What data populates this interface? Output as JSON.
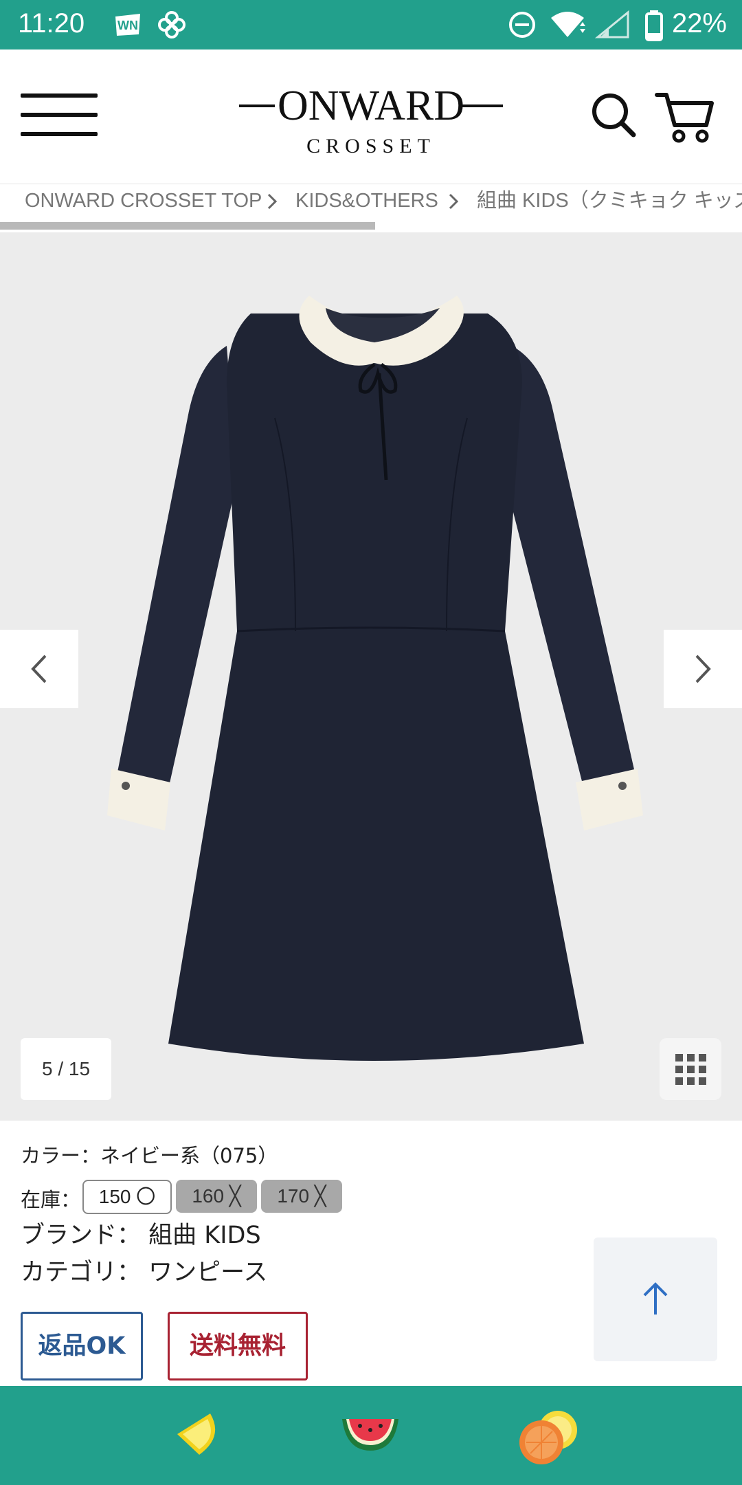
{
  "status_bar": {
    "time": "11:20",
    "battery": "22%",
    "icons": [
      "weather-news-icon",
      "pinwheel-icon",
      "do-not-disturb-icon",
      "wifi-icon",
      "signal-icon",
      "battery-icon"
    ]
  },
  "header": {
    "logo_main": "ONWARD",
    "logo_sub": "CROSSET",
    "icons": [
      "menu-icon",
      "search-icon",
      "cart-icon"
    ]
  },
  "breadcrumb": {
    "items": [
      "ONWARD CROSSET TOP",
      "KIDS&OTHERS",
      "組曲 KIDS（クミキョク キッズ）"
    ]
  },
  "gallery": {
    "counter": "5 / 15",
    "position": 5,
    "total": 15,
    "background": "#ececec"
  },
  "product": {
    "color_line": "カラー：ネイビー系（075）",
    "stock_label": "在庫：",
    "sizes": [
      {
        "label": "150 〇",
        "available": true
      },
      {
        "label": "160 ╳",
        "available": false
      },
      {
        "label": "170 ╳",
        "available": false
      }
    ],
    "brand_line": "ブランド： 組曲 KIDS",
    "category_line": "カテゴリ： ワンピース",
    "badge_return": "返品OK",
    "badge_shipping": "送料無料"
  },
  "colors": {
    "brand_teal": "#22a08c",
    "return_blue": "#2c5a92",
    "ship_red": "#a82232",
    "scroll_arrow": "#2f6fc4"
  },
  "bottom_bar": {
    "items": [
      "lemon-slice-icon",
      "watermelon-icon",
      "grapefruit-icon"
    ]
  }
}
